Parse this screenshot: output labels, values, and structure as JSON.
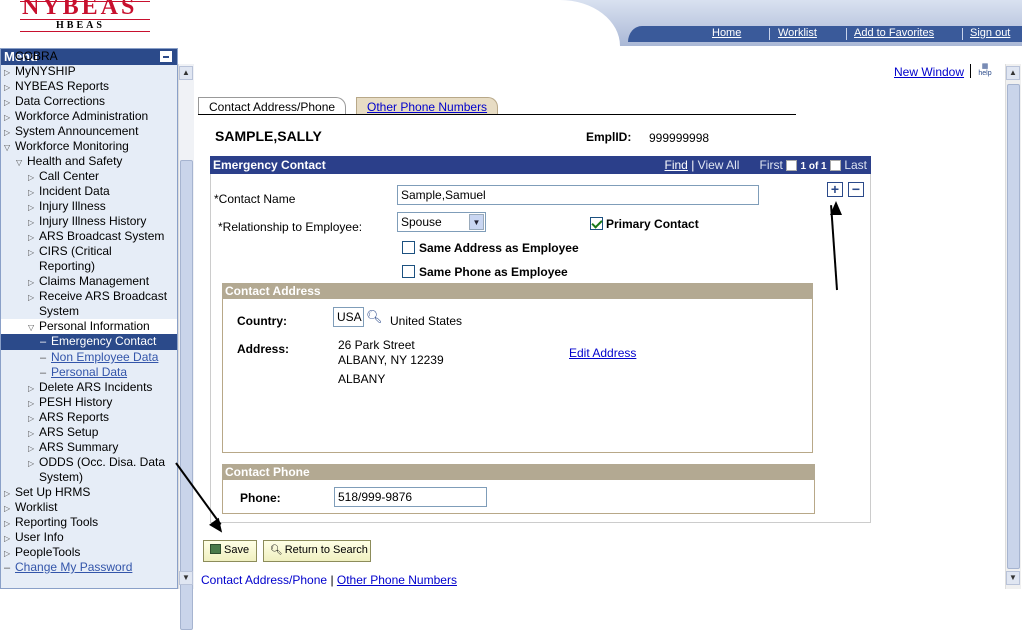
{
  "header": {
    "logo_main": "NYBEAS",
    "logo_sub": "HBEAS",
    "nav": [
      "Home",
      "Worklist",
      "Add to Favorites",
      "Sign out"
    ]
  },
  "menu": {
    "title": "Menu",
    "items": [
      {
        "label": "COBRA",
        "indent": 0,
        "tri": "",
        "style": "cut"
      },
      {
        "label": "MyNYSHIP",
        "indent": 0,
        "tri": "closed"
      },
      {
        "label": "NYBEAS Reports",
        "indent": 0,
        "tri": "closed"
      },
      {
        "label": "Data Corrections",
        "indent": 0,
        "tri": "closed"
      },
      {
        "label": "Workforce Administration",
        "indent": 0,
        "tri": "closed"
      },
      {
        "label": "System Announcement",
        "indent": 0,
        "tri": "closed"
      },
      {
        "label": "Workforce Monitoring",
        "indent": 0,
        "tri": "open"
      },
      {
        "label": "Health and Safety",
        "indent": 1,
        "tri": "open"
      },
      {
        "label": "Call Center",
        "indent": 2,
        "tri": "closed"
      },
      {
        "label": "Incident Data",
        "indent": 2,
        "tri": "closed"
      },
      {
        "label": "Injury Illness",
        "indent": 2,
        "tri": "closed"
      },
      {
        "label": "Injury Illness History",
        "indent": 2,
        "tri": "closed"
      },
      {
        "label": "ARS Broadcast System",
        "indent": 2,
        "tri": "closed"
      },
      {
        "label": "CIRS (Critical",
        "indent": 2,
        "tri": "closed"
      },
      {
        "label": "Reporting)",
        "indent": 2,
        "tri": "",
        "cont": true
      },
      {
        "label": "Claims Management",
        "indent": 2,
        "tri": "closed"
      },
      {
        "label": "Receive ARS Broadcast",
        "indent": 2,
        "tri": "closed"
      },
      {
        "label": "System",
        "indent": 2,
        "tri": "",
        "cont": true
      },
      {
        "label": "Personal Information",
        "indent": 2,
        "tri": "open",
        "style": "wbg"
      },
      {
        "label": "Emergency Contact",
        "indent": 3,
        "tri": "dash",
        "style": "sel"
      },
      {
        "label": "Non Employee Data",
        "indent": 3,
        "tri": "dash",
        "style": "ul"
      },
      {
        "label": "Personal Data",
        "indent": 3,
        "tri": "dash",
        "style": "ul"
      },
      {
        "label": "Delete ARS Incidents",
        "indent": 2,
        "tri": "closed"
      },
      {
        "label": "PESH History",
        "indent": 2,
        "tri": "closed"
      },
      {
        "label": "ARS Reports",
        "indent": 2,
        "tri": "closed"
      },
      {
        "label": "ARS Setup",
        "indent": 2,
        "tri": "closed"
      },
      {
        "label": "ARS Summary",
        "indent": 2,
        "tri": "closed"
      },
      {
        "label": "ODDS (Occ. Disa. Data",
        "indent": 2,
        "tri": "closed"
      },
      {
        "label": "System)",
        "indent": 2,
        "tri": "",
        "cont": true
      },
      {
        "label": "Set Up HRMS",
        "indent": 0,
        "tri": "closed"
      },
      {
        "label": "Worklist",
        "indent": 0,
        "tri": "closed"
      },
      {
        "label": "Reporting Tools",
        "indent": 0,
        "tri": "closed"
      },
      {
        "label": "User Info",
        "indent": 0,
        "tri": "closed"
      },
      {
        "label": "PeopleTools",
        "indent": 0,
        "tri": "closed"
      },
      {
        "label": "Change My Password",
        "indent": 0,
        "tri": "dash",
        "style": "ul"
      }
    ]
  },
  "page": {
    "new_window": "New Window",
    "tabs": [
      "Contact Address/Phone",
      "Other Phone Numbers"
    ],
    "employee_name": "SAMPLE,SALLY",
    "emplid_label": "EmplID:",
    "emplid_value": "999999998",
    "emergency": {
      "title": "Emergency Contact",
      "find": "Find",
      "view_all": "View All",
      "first": "First",
      "counter": "1 of 1",
      "last": "Last",
      "contact_name_label": "*Contact Name",
      "contact_name_value": "Sample,Samuel",
      "relationship_label": "*Relationship to Employee:",
      "relationship_value": "Spouse",
      "primary_contact_label": "Primary Contact",
      "same_address_label": "Same Address as Employee",
      "same_phone_label": "Same Phone as Employee"
    },
    "address": {
      "title": "Contact Address",
      "country_label": "Country:",
      "country_value": "USA",
      "country_name": "United States",
      "address_label": "Address:",
      "line1": "26 Park Street",
      "line2": "ALBANY, NY 12239",
      "line3": "ALBANY",
      "edit_link": "Edit Address"
    },
    "phone": {
      "title": "Contact Phone",
      "phone_label": "Phone:",
      "phone_value": "518/999-9876"
    },
    "buttons": {
      "save": "Save",
      "return": "Return to Search"
    },
    "footer_links": [
      "Contact Address/Phone",
      "Other Phone Numbers"
    ]
  }
}
